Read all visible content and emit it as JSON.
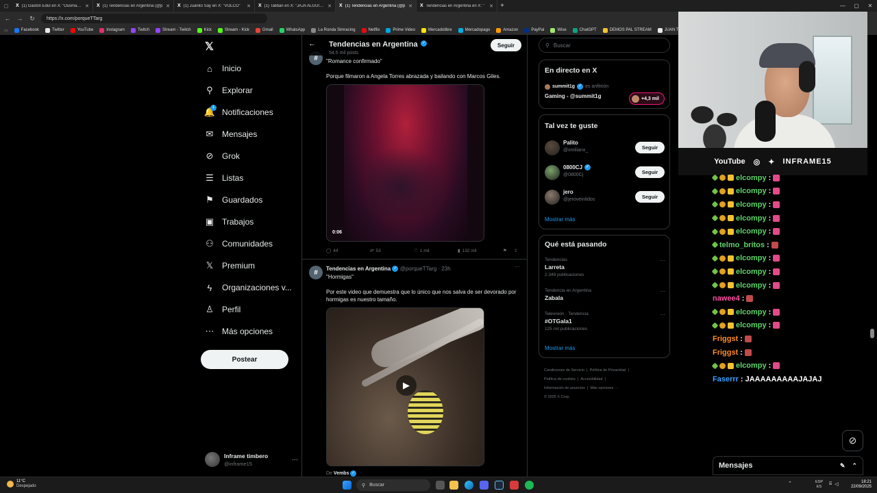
{
  "browser": {
    "tabs": [
      {
        "title": "(1) Gastón Edul en X: \"Ousmane\"",
        "active": false
      },
      {
        "title": "(1) Tendencias en Argentina (@p",
        "active": false
      },
      {
        "title": "(1) Juanito Say en X: \"VOLCÓ\"",
        "active": false
      },
      {
        "title": "(1) Taliban en X: \"JAJA ALGUIEN\"",
        "active": false
      },
      {
        "title": "(1) Tendencias en Argentina (@p",
        "active": true
      },
      {
        "title": "Tendencias en Argentina en X: \"",
        "active": false
      }
    ],
    "url": "https://x.com/porqueTTarg",
    "bookmarks": [
      {
        "label": "Facebook",
        "color": "#1877f2"
      },
      {
        "label": "Twitter",
        "color": "#e7e9ea"
      },
      {
        "label": "YouTube",
        "color": "#ff0000"
      },
      {
        "label": "Instagram",
        "color": "#e1306c"
      },
      {
        "label": "Twitch",
        "color": "#9146ff"
      },
      {
        "label": "Stream - Twitch",
        "color": "#9146ff"
      },
      {
        "label": "Kick",
        "color": "#53fc18"
      },
      {
        "label": "Stream - Kick",
        "color": "#53fc18"
      },
      {
        "label": "Gmail",
        "color": "#ea4335"
      },
      {
        "label": "WhatsApp",
        "color": "#25d366"
      },
      {
        "label": "La Ronda Simracing",
        "color": "#888888"
      },
      {
        "label": "Netflix",
        "color": "#e50914"
      },
      {
        "label": "Prime Video",
        "color": "#00a8e1"
      },
      {
        "label": "Mercadolibre",
        "color": "#ffe600"
      },
      {
        "label": "Mercadopago",
        "color": "#00b1ea"
      },
      {
        "label": "Amazon",
        "color": "#ff9900"
      },
      {
        "label": "PayPal",
        "color": "#003087"
      },
      {
        "label": "Wise",
        "color": "#9fe870"
      },
      {
        "label": "ChatGPT",
        "color": "#10a37f"
      },
      {
        "label": "DEMOS PAL STREAM",
        "color": "#f4c430"
      },
      {
        "label": "JUAN TUR",
        "color": "#e7e9ea"
      }
    ]
  },
  "nav": {
    "items": [
      {
        "label": "Inicio",
        "icon": "home-icon",
        "glyph": "⌂"
      },
      {
        "label": "Explorar",
        "icon": "search-icon",
        "glyph": "⚲"
      },
      {
        "label": "Notificaciones",
        "icon": "bell-icon",
        "glyph": "🔔"
      },
      {
        "label": "Mensajes",
        "icon": "mail-icon",
        "glyph": "✉"
      },
      {
        "label": "Grok",
        "icon": "grok-icon",
        "glyph": "⊘"
      },
      {
        "label": "Listas",
        "icon": "list-icon",
        "glyph": "☰"
      },
      {
        "label": "Guardados",
        "icon": "bookmark-icon",
        "glyph": "⚑"
      },
      {
        "label": "Trabajos",
        "icon": "briefcase-icon",
        "glyph": "▣"
      },
      {
        "label": "Comunidades",
        "icon": "people-icon",
        "glyph": "⚇"
      },
      {
        "label": "Premium",
        "icon": "x-logo-icon",
        "glyph": "𝕏"
      },
      {
        "label": "Organizaciones v...",
        "icon": "lightning-icon",
        "glyph": "ϟ"
      },
      {
        "label": "Perfil",
        "icon": "person-icon",
        "glyph": "♙"
      },
      {
        "label": "Más opciones",
        "icon": "more-circle-icon",
        "glyph": "⋯"
      }
    ],
    "notification_count": "1",
    "post_label": "Postear",
    "profile_name": "Inframe timbero",
    "profile_handle": "@inframe15"
  },
  "header": {
    "title": "Tendencias en Argentina",
    "subtitle": "54,5 mil posts",
    "follow_label": "Seguir"
  },
  "tweets": [
    {
      "quote": "\"Romance confirmado\"",
      "text": "Porque filmaron a Angela Torres abrazada y bailando con Marcos Giles.",
      "video_time": "0:06",
      "replies": "44",
      "retweets": "53",
      "likes": "1 mil",
      "views": "132 mil"
    },
    {
      "author": "Tendencias en Argentina",
      "handle": "@porqueTTarg · 23h",
      "quote": "\"Hormigas\"",
      "text": "Por este video que demuestra que lo único que nos salva de ser devorado por hormigas es nuestro tamaño.",
      "source_prefix": "De",
      "source": "Vembs"
    }
  ],
  "right": {
    "search_placeholder": "Buscar",
    "live": {
      "title": "En directo en X",
      "host": "summit1g",
      "status": "es anfitrión",
      "name": "Gaming - @summit1g",
      "listeners": "+4,3 mil"
    },
    "suggestions": {
      "title": "Tal vez te guste",
      "items": [
        {
          "name": "Palito",
          "handle": "@xmilianx_",
          "button": "Seguir",
          "color": "#5a4a3a"
        },
        {
          "name": "0800CJ",
          "handle": "@0800Cj",
          "button": "Seguir",
          "color": "#7aa36a"
        },
        {
          "name": "jero",
          "handle": "@jeroveintidos",
          "button": "Seguir",
          "color": "#8a7a6a"
        }
      ],
      "more": "Mostrar más"
    },
    "trends": {
      "title": "Qué está pasando",
      "items": [
        {
          "category": "Tendencias",
          "name": "Larreta",
          "count": "2.349 publicaciones"
        },
        {
          "category": "Tendencia en Argentina",
          "name": "Zabala",
          "count": ""
        },
        {
          "category": "Televisión · Tendencia",
          "name": "#OTGala1",
          "count": "125 mil publicaciones"
        }
      ],
      "more": "Mostrar más"
    },
    "footer": {
      "line1": [
        "Condiciones de Servicio",
        "Política de Privacidad"
      ],
      "line2": [
        "Política de cookies",
        "Accesibilidad"
      ],
      "line3": [
        "Información de anuncios",
        "Más opciones ···"
      ],
      "copyright": "© 2025 X Corp."
    }
  },
  "stream": {
    "labels": [
      "YouTube",
      "INFRAME15"
    ],
    "chat": [
      {
        "user": "elcompy",
        "color": "#5fd36a"
      },
      {
        "user": "elcompy",
        "color": "#5fd36a"
      },
      {
        "user": "elcompy",
        "color": "#5fd36a"
      },
      {
        "user": "elcompy",
        "color": "#5fd36a"
      },
      {
        "user": "elcompy",
        "color": "#5fd36a"
      },
      {
        "user": "telmo_britos",
        "color": "#5fd36a"
      },
      {
        "user": "elcompy",
        "color": "#5fd36a"
      },
      {
        "user": "elcompy",
        "color": "#5fd36a"
      },
      {
        "user": "elcompy",
        "color": "#5fd36a"
      },
      {
        "user": "nawee4",
        "color": "#ff4fa3"
      },
      {
        "user": "elcompy",
        "color": "#5fd36a"
      },
      {
        "user": "elcompy",
        "color": "#5fd36a"
      },
      {
        "user": "Friggst",
        "color": "#ff8c2a"
      },
      {
        "user": "Friggst",
        "color": "#ff8c2a"
      },
      {
        "user": "elcompy",
        "color": "#5fd36a"
      },
      {
        "user": "Faserrr",
        "color": "#3aa0ff",
        "message": "JAAAAAAAAAJAJAJ"
      }
    ]
  },
  "messages_panel": {
    "label": "Mensajes"
  },
  "taskbar": {
    "weather_temp": "11°C",
    "weather_desc": "Despejado",
    "search_placeholder": "Buscar",
    "lang1": "ESP",
    "lang2": "ES",
    "time": "18:21",
    "date": "22/09/2025"
  }
}
